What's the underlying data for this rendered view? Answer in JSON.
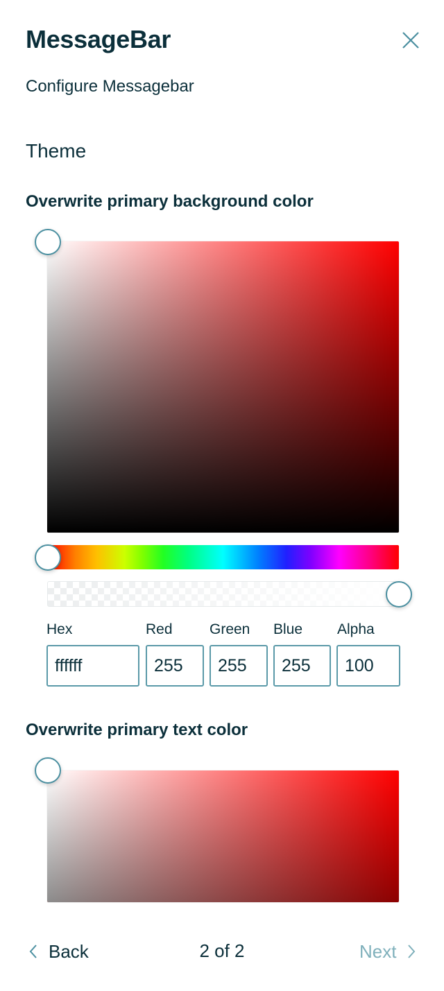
{
  "header": {
    "title": "MessageBar",
    "subtitle": "Configure Messagebar",
    "close_icon": "close-icon"
  },
  "section_title": "Theme",
  "background_color_picker": {
    "heading": "Overwrite primary background color",
    "hue_deg": 0,
    "saturation": 0,
    "value": 100,
    "alpha": 100,
    "fields": {
      "hex": {
        "label": "Hex",
        "value": "ffffff"
      },
      "red": {
        "label": "Red",
        "value": "255"
      },
      "green": {
        "label": "Green",
        "value": "255"
      },
      "blue": {
        "label": "Blue",
        "value": "255"
      },
      "alpha": {
        "label": "Alpha",
        "value": "100"
      }
    }
  },
  "text_color_picker": {
    "heading": "Overwrite primary text color",
    "hue_deg": 0,
    "saturation": 0,
    "value": 100
  },
  "footer": {
    "back_label": "Back",
    "back_icon": "chevron-left-icon",
    "page_indicator": "2 of 2",
    "next_label": "Next",
    "next_icon": "chevron-right-icon",
    "next_disabled": true
  },
  "colors": {
    "text_primary": "#0b2f3a",
    "accent": "#4a8fa0",
    "disabled": "#7fb0bb",
    "picker_hue": "#ff0000"
  }
}
